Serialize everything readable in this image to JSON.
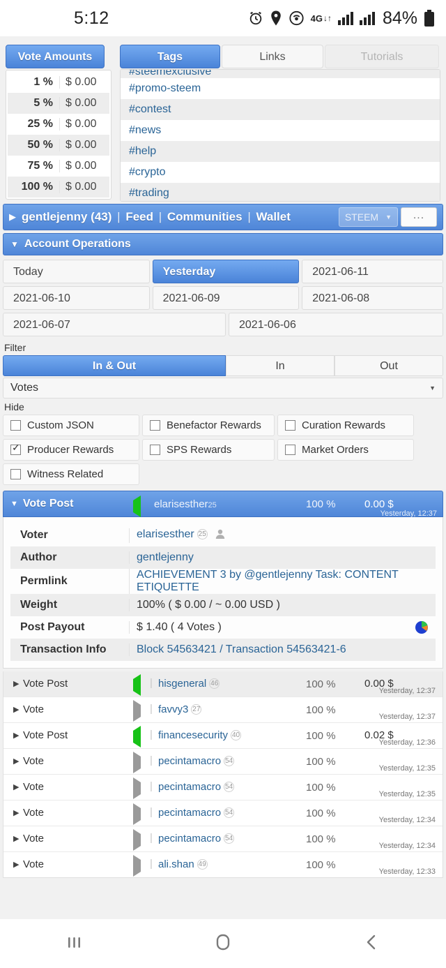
{
  "status_bar": {
    "time": "5:12",
    "battery": "84%",
    "network": "4G",
    "icons": [
      "alarm-icon",
      "location-icon",
      "hotspot-icon",
      "network-4g-icon",
      "signal-bars-icon",
      "signal-bars-icon",
      "battery-icon"
    ]
  },
  "vote_amounts_panel": {
    "tab_label": "Vote Amounts",
    "rows": [
      {
        "pct": "1 %",
        "amount": "$ 0.00"
      },
      {
        "pct": "5 %",
        "amount": "$ 0.00"
      },
      {
        "pct": "25 %",
        "amount": "$ 0.00"
      },
      {
        "pct": "50 %",
        "amount": "$ 0.00"
      },
      {
        "pct": "75 %",
        "amount": "$ 0.00"
      },
      {
        "pct": "100 %",
        "amount": "$ 0.00"
      }
    ]
  },
  "tags_panel": {
    "tabs": [
      {
        "label": "Tags",
        "state": "active"
      },
      {
        "label": "Links",
        "state": "normal"
      },
      {
        "label": "Tutorials",
        "state": "disabled"
      }
    ],
    "items": [
      "#steemexclusive",
      "#promo-steem",
      "#contest",
      "#news",
      "#help",
      "#crypto",
      "#trading"
    ]
  },
  "navbar": {
    "account": "gentlejenny (43)",
    "sep": "|",
    "links": [
      "Feed",
      "Communities",
      "Wallet"
    ],
    "currency": "STEEM",
    "more_label": "..."
  },
  "account_operations": {
    "title": "Account Operations",
    "date_rows": [
      [
        {
          "label": "Today",
          "selected": false
        },
        {
          "label": "Yesterday",
          "selected": true
        },
        {
          "label": "2021-06-11",
          "selected": false
        }
      ],
      [
        {
          "label": "2021-06-10",
          "selected": false
        },
        {
          "label": "2021-06-09",
          "selected": false
        },
        {
          "label": "2021-06-08",
          "selected": false
        }
      ],
      [
        {
          "label": "2021-06-07",
          "selected": false
        },
        {
          "label": "2021-06-06",
          "selected": false
        }
      ]
    ]
  },
  "filter": {
    "label": "Filter",
    "segments": [
      {
        "label": "In & Out",
        "selected": true
      },
      {
        "label": "In",
        "selected": false
      },
      {
        "label": "Out",
        "selected": false
      }
    ],
    "type_select": {
      "value": "Votes"
    }
  },
  "hide": {
    "label": "Hide",
    "rows": [
      [
        {
          "label": "Custom JSON",
          "checked": false
        },
        {
          "label": "Benefactor Rewards",
          "checked": false
        },
        {
          "label": "Curation Rewards",
          "checked": false
        }
      ],
      [
        {
          "label": "Producer Rewards",
          "checked": true
        },
        {
          "label": "SPS Rewards",
          "checked": false
        },
        {
          "label": "Market Orders",
          "checked": false
        }
      ],
      [
        {
          "label": "Witness Related",
          "checked": false
        }
      ]
    ]
  },
  "expanded_operation": {
    "type": "Vote Post",
    "direction": "in",
    "user": "elarisesther",
    "user_reputation": "25",
    "percent": "100 %",
    "amount": "0.00 $",
    "timestamp": "Yesterday, 12:37",
    "details": [
      {
        "key": "Voter",
        "value": "elarisesther",
        "reputation": "25",
        "link": true,
        "avatar": true
      },
      {
        "key": "Author",
        "value": "gentlejenny",
        "link": true
      },
      {
        "key": "Permlink",
        "value": "ACHIEVEMENT 3 by @gentlejenny Task: CONTENT ETIQUETTE",
        "link": true
      },
      {
        "key": "Weight",
        "value": "100% ( $ 0.00 / ~ 0.00 USD )",
        "link": false
      },
      {
        "key": "Post Payout",
        "value": "$ 1.40 ( 4 Votes )",
        "link": false,
        "pie": true
      },
      {
        "key": "Transaction Info",
        "value": "Block 54563421 / Transaction 54563421-6",
        "link": true
      }
    ]
  },
  "operation_list": [
    {
      "type": "Vote Post",
      "direction": "in",
      "user": "hisgeneral",
      "reputation": "46",
      "percent": "100 %",
      "amount": "0.00 $",
      "timestamp": "Yesterday, 12:37"
    },
    {
      "type": "Vote",
      "direction": "out",
      "user": "favvy3",
      "reputation": "27",
      "percent": "100 %",
      "amount": "",
      "timestamp": "Yesterday, 12:37"
    },
    {
      "type": "Vote Post",
      "direction": "in",
      "user": "financesecurity",
      "reputation": "40",
      "percent": "100 %",
      "amount": "0.02 $",
      "timestamp": "Yesterday, 12:36"
    },
    {
      "type": "Vote",
      "direction": "out",
      "user": "pecintamacro",
      "reputation": "54",
      "percent": "100 %",
      "amount": "",
      "timestamp": "Yesterday, 12:35"
    },
    {
      "type": "Vote",
      "direction": "out",
      "user": "pecintamacro",
      "reputation": "54",
      "percent": "100 %",
      "amount": "",
      "timestamp": "Yesterday, 12:35"
    },
    {
      "type": "Vote",
      "direction": "out",
      "user": "pecintamacro",
      "reputation": "54",
      "percent": "100 %",
      "amount": "",
      "timestamp": "Yesterday, 12:34"
    },
    {
      "type": "Vote",
      "direction": "out",
      "user": "pecintamacro",
      "reputation": "54",
      "percent": "100 %",
      "amount": "",
      "timestamp": "Yesterday, 12:34"
    },
    {
      "type": "Vote",
      "direction": "out",
      "user": "ali.shan",
      "reputation": "49",
      "percent": "100 %",
      "amount": "",
      "timestamp": "Yesterday, 12:33"
    }
  ],
  "bottom_nav": {
    "items": [
      "recents-icon",
      "home-icon",
      "back-icon"
    ]
  },
  "colors": {
    "accent_blue": "#4f86d8",
    "link_blue": "#2a6496",
    "vote_in_green": "#17c217",
    "vote_out_gray": "#9a9a9a"
  }
}
